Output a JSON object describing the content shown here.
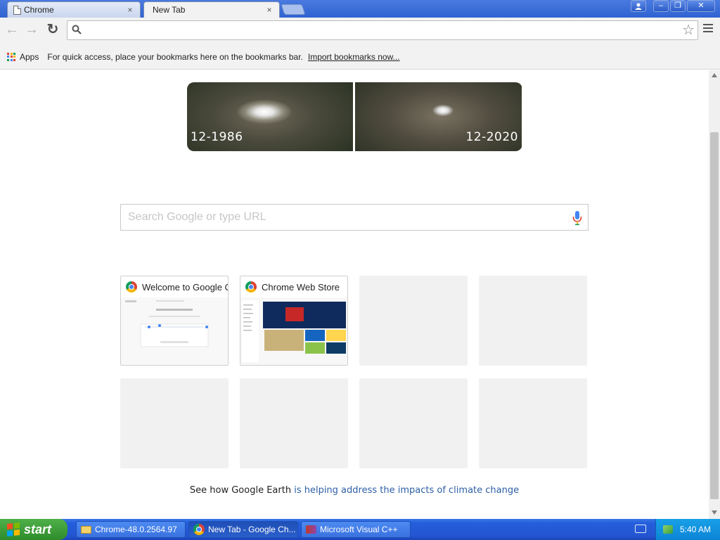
{
  "tabs": [
    {
      "title": "Chrome",
      "close": "×"
    },
    {
      "title": "New Tab",
      "close": "×"
    }
  ],
  "window_controls": {
    "minimize": "–",
    "maximize": "❐",
    "close": "✕"
  },
  "toolbar": {
    "back": "←",
    "forward": "→",
    "reload": "↻",
    "address_value": "",
    "star": "☆"
  },
  "bookmarks_bar": {
    "apps_label": "Apps",
    "hint": "For quick access, place your bookmarks here on the bookmarks bar.",
    "import_link": "Import bookmarks now..."
  },
  "doodle": {
    "left_label": "12-1986",
    "right_label": "12-2020"
  },
  "ntp_search": {
    "placeholder": "Search Google or type URL"
  },
  "tiles": [
    {
      "title": "Welcome to Google Chrome"
    },
    {
      "title": "Chrome Web Store"
    }
  ],
  "footer": {
    "prefix": "See how Google Earth ",
    "link": "is helping address the impacts of climate change"
  },
  "taskbar": {
    "start_label": "start",
    "tasks": [
      {
        "label": "Chrome-48.0.2564.97"
      },
      {
        "label": "New Tab - Google Ch..."
      },
      {
        "label": "Microsoft Visual C++"
      }
    ],
    "clock": "5:40 AM"
  },
  "colors": {
    "accent_link": "#2d5fa5",
    "titlebar": "#2f63d0",
    "taskbar": "#245edb",
    "start_button": "#3c9c38"
  }
}
